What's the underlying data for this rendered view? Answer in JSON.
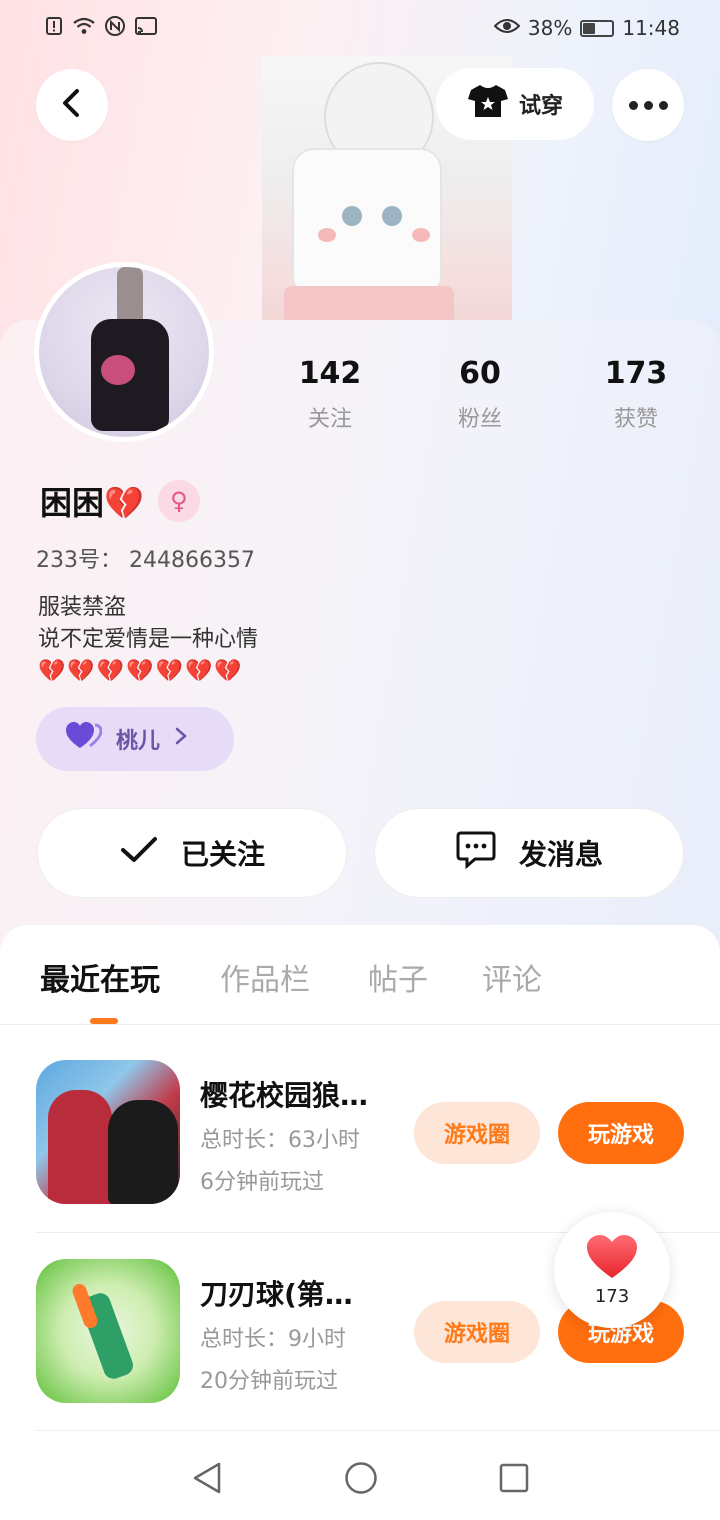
{
  "status_bar": {
    "battery": "38%",
    "time": "11:48"
  },
  "header": {
    "try_on_label": "试穿"
  },
  "profile": {
    "stats": [
      {
        "num": "142",
        "label": "关注"
      },
      {
        "num": "60",
        "label": "粉丝"
      },
      {
        "num": "173",
        "label": "获赞"
      }
    ],
    "name": "困困💔",
    "uid": "233号： 244866357",
    "bio_lines": [
      "服装禁盗",
      "说不定爱情是一种心情"
    ],
    "bio_hearts": "💔💔💔💔💔💔💔",
    "tag_label": "桃儿"
  },
  "actions": {
    "follow_label": "已关注",
    "message_label": "发消息"
  },
  "tabs": [
    "最近在玩",
    "作品栏",
    "帖子",
    "评论"
  ],
  "games": [
    {
      "title": "樱花校园狼…",
      "duration": "总时长：63小时",
      "last_played": "6分钟前玩过",
      "circle_label": "游戏圈",
      "play_label": "玩游戏"
    },
    {
      "title": "刀刃球(第…",
      "duration": "总时长：9小时",
      "last_played": "20分钟前玩过",
      "circle_label": "游戏圈",
      "play_label": "玩游戏"
    }
  ],
  "like_float": {
    "count": "173"
  },
  "colors": {
    "accent": "#ff6e0f",
    "accent_soft": "#fde6d8",
    "tag_bg": "#e6dcf7"
  }
}
